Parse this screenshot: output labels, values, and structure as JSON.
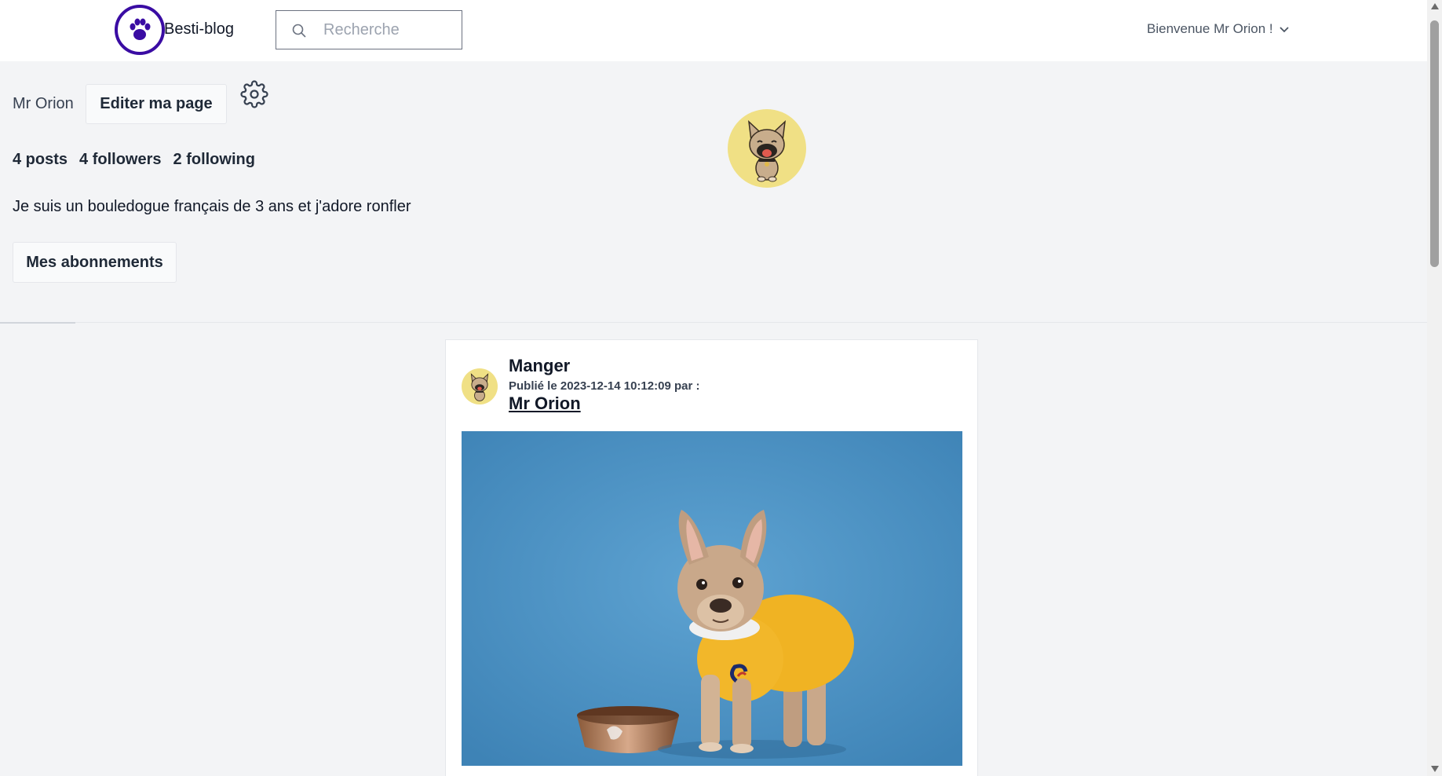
{
  "header": {
    "brand": "Besti-blog",
    "search_placeholder": "Recherche",
    "welcome": "Bienvenue Mr Orion !"
  },
  "profile": {
    "name": "Mr Orion",
    "edit_button": "Editer ma page",
    "stats": {
      "posts": "4 posts",
      "followers": "4 followers",
      "following": "2 following"
    },
    "bio": "Je suis un bouledogue français de 3 ans et j'adore ronfler",
    "subscriptions_button": "Mes abonnements"
  },
  "post": {
    "title": "Manger",
    "meta": "Publié le 2023-12-14 10:12:09 par :",
    "author": "Mr Orion"
  },
  "colors": {
    "logo": "#3a0ca3",
    "avatar_bg": "#f0e085",
    "photo_bg": "#4f93c4",
    "sweater": "#f0b323"
  },
  "icons": {
    "logo": "paw-icon",
    "search": "search-icon",
    "settings": "gear-icon",
    "dropdown": "chevron-down-icon"
  }
}
